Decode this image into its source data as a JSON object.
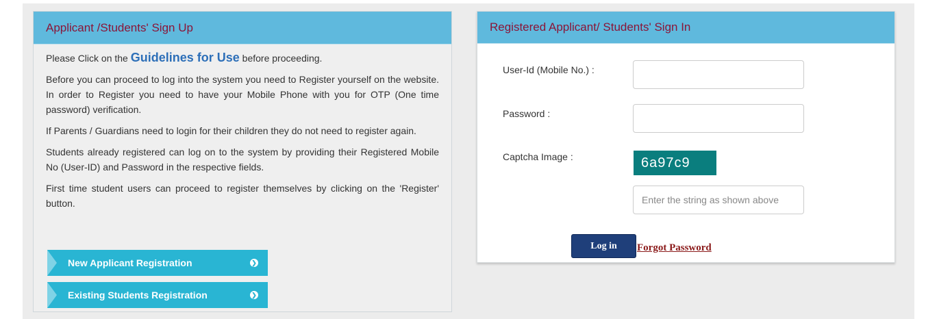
{
  "signup": {
    "heading": "Applicant /Students' Sign Up",
    "intro_prefix": "Please Click on the ",
    "guidelines_link": "Guidelines for Use",
    "intro_suffix": " before proceeding.",
    "paragraphs": [
      "Before you can proceed to log into the system you need to Register yourself on the website. In order to Register you need to have your Mobile Phone with you for OTP (One time password) verification.",
      "If Parents / Guardians need to login for their children they do not need to register again.",
      "Students already registered can log on to the system by providing their Registered Mobile No (User-ID) and Password in the respective fields.",
      "First time student users can proceed to register themselves by clicking on the 'Register' button."
    ],
    "buttons": {
      "new_applicant": "New Applicant Registration",
      "existing_students": "Existing Students Registration"
    }
  },
  "signin": {
    "heading": "Registered Applicant/ Students' Sign In",
    "userid_label": "User-Id (Mobile No.) :",
    "userid_value": "",
    "password_label": "Password :",
    "password_value": "",
    "captcha_label": "Captcha Image :",
    "captcha_text": "6a97c9",
    "captcha_placeholder": "Enter the string as shown above",
    "login_button": "Log in",
    "forgot_link": "Forgot Password"
  },
  "colors": {
    "header_bg": "#5fb9dd",
    "header_text": "#8a1538",
    "reg_button_bg": "#29b5d3",
    "captcha_bg": "#0a7e7e",
    "login_button_bg": "#1f3f7a",
    "forgot_link": "#8b1a1a"
  },
  "icons": {
    "reg_button_arrow": "chevron-right-circle-icon"
  }
}
